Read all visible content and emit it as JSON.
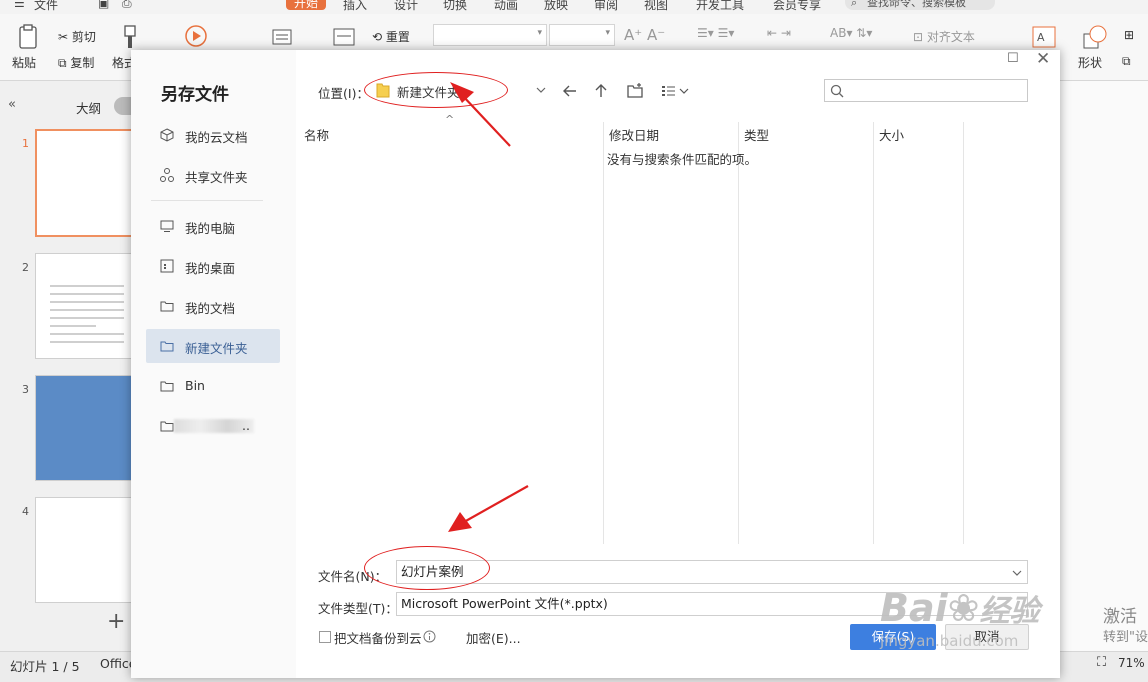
{
  "menubar": {
    "file": "文件",
    "tabs": [
      "插入",
      "设计",
      "切换",
      "动画",
      "放映",
      "审阅",
      "视图",
      "开发工具",
      "会员专享"
    ],
    "active_tab": "开始",
    "search": "查找命令、搜索模板"
  },
  "ribbon": {
    "paste": "粘贴",
    "cut": "剪切",
    "copy": "复制",
    "format_painter": "格式",
    "reset": "重置",
    "align_text": "对齐文本",
    "shape": "形状"
  },
  "left_panel": {
    "outline_tab": "大纲",
    "slide_numbers": [
      "1",
      "2",
      "3",
      "4"
    ],
    "add_symbol": "+"
  },
  "statusbar": {
    "slide_position": "幻灯片 1 / 5",
    "theme": "Office",
    "zoom": "71%",
    "activate_line1": "激活",
    "activate_line2": "转到\"设"
  },
  "dialog": {
    "title": "另存文件",
    "nav": {
      "cloud": "我的云文档",
      "shared": "共享文件夹",
      "computer": "我的电脑",
      "desktop": "我的桌面",
      "documents": "我的文档",
      "new_folder": "新建文件夹",
      "bin": "Bin",
      "blurred": ".."
    },
    "location_label": "位置(I)：",
    "location_value": "新建文件夹",
    "columns": {
      "name": "名称",
      "modified": "修改日期",
      "type": "类型",
      "size": "大小"
    },
    "empty_message": "没有与搜索条件匹配的项。",
    "filename_label": "文件名(N)：",
    "filename_value": "幻灯片案例",
    "filetype_label": "文件类型(T)：",
    "filetype_value": "Microsoft PowerPoint 文件(*.pptx)",
    "backup_label": "把文档备份到云",
    "encrypt_label": "加密(E)...",
    "save_label": "保存(S)",
    "cancel_label": "取消"
  },
  "watermark": {
    "brand": "Bai",
    "brand_cn": "经验",
    "url": "jingyan.baidu.com"
  },
  "colors": {
    "accent_orange": "#e8713d",
    "save_blue": "#3d7fe0",
    "annotation_red": "#e02020",
    "active_nav": "#dce4ee"
  }
}
